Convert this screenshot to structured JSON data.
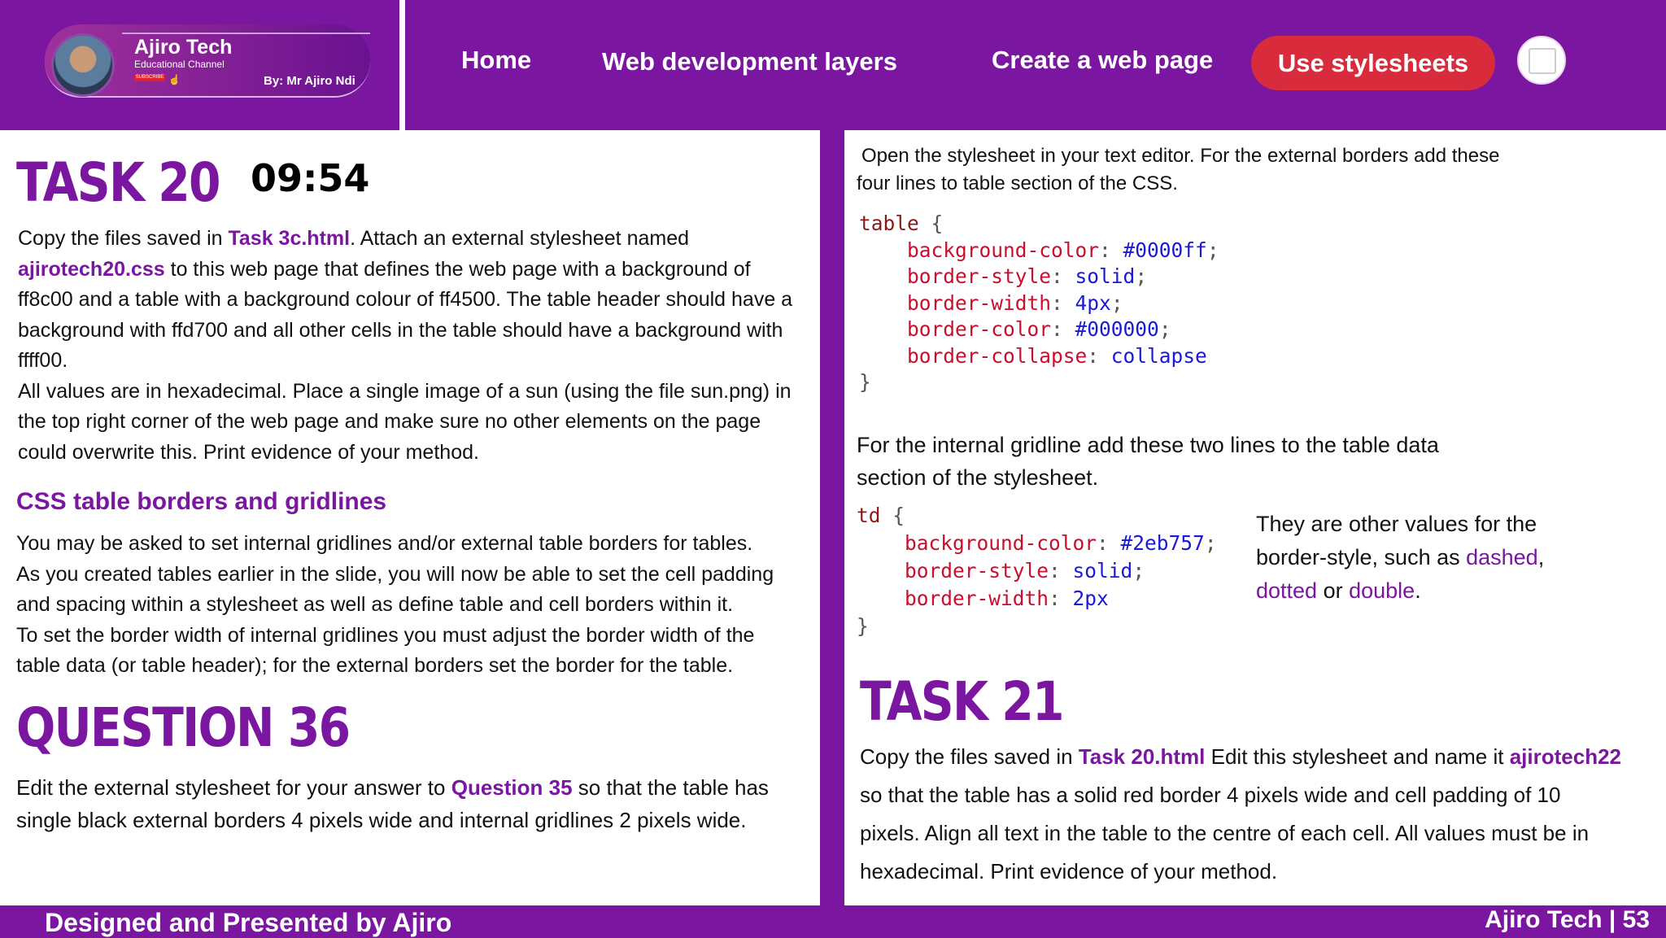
{
  "header": {
    "brand_title": "Ajiro Tech",
    "brand_sub": "Educational Channel",
    "subscribe_label": "SUBSCRIBE",
    "byline": "By: Mr Ajiro Ndi",
    "nav": [
      "Home",
      "Web development layers",
      "Create a web page",
      "Use stylesheets"
    ]
  },
  "left": {
    "task_title": "TASK 20",
    "timer": "09:54",
    "task_text": {
      "p1_a": "Copy the files saved in ",
      "p1_link": "Task 3c.html",
      "p1_b": ". Attach an external stylesheet named",
      "p2_link": "ajirotech20.css",
      "p2_b": " to this web page that defines the web page with a background of",
      "line3": "ff8c00 and a table with a background colour of ff4500. The table header should have a",
      "line4": "background with ffd700 and all other cells in the table should have a background with",
      "line5": "ffff00.",
      "line6": "All values are in hexadecimal. Place a single image of a sun (using the file sun.png) in",
      "line7": "the top right corner of the web page and make sure no other elements on the page",
      "line8": "could overwrite this. Print evidence of your method."
    },
    "subhead": "CSS table borders and gridlines",
    "borders_text": [
      "You may be asked to set internal gridlines and/or external table borders for tables.",
      "As you created tables earlier in the slide, you will now be able to set the cell padding",
      "and spacing within a stylesheet as well as define table and cell borders within it.",
      "To set the border width of internal gridlines you must adjust the border width of the",
      "table data (or table header); for the external borders set the border for the table."
    ],
    "question_title": "QUESTION 36",
    "question_text": {
      "a": "Edit the external stylesheet for your answer to ",
      "link": "Question 35",
      "b": " so that the table has",
      "line2": "single black external borders 4 pixels wide and internal gridlines 2 pixels wide."
    }
  },
  "right": {
    "intro": [
      "Open the stylesheet in your text editor. For the external borders add these",
      "four lines to table section of the CSS."
    ],
    "code_table": {
      "selector": "table",
      "open": "{",
      "close": "}",
      "decls": [
        {
          "prop": "background-color",
          "value": "#0000ff"
        },
        {
          "prop": "border-style",
          "value": "solid"
        },
        {
          "prop": "border-width",
          "value": "4px"
        },
        {
          "prop": "border-color",
          "value": "#000000"
        },
        {
          "prop": "border-collapse",
          "value": "collapse",
          "nosemi": true
        }
      ]
    },
    "gridline_text": [
      "For the internal gridline add these two lines to the table data",
      "section of the stylesheet."
    ],
    "code_td": {
      "selector": "td",
      "open": "{",
      "close": "}",
      "decls": [
        {
          "prop": "background-color",
          "value": "#2eb757"
        },
        {
          "prop": "border-style",
          "value": "solid"
        },
        {
          "prop": "border-width",
          "value": "2px",
          "nosemi": true
        }
      ]
    },
    "note": {
      "line1": "They are other values for the",
      "line2_a": "border-style, such as ",
      "dashed": "dashed",
      "comma": ",",
      "dotted": "dotted",
      "or": " or ",
      "double": "double",
      "period": "."
    },
    "task21_title": "TASK 21",
    "task21": {
      "a": "Copy the files saved in ",
      "link1": "Task 20.html",
      "b": " Edit this stylesheet and name it ",
      "link2": "ajirotech22",
      "line2": "so that the table has a solid red border 4 pixels wide and cell padding of 10",
      "line3": "pixels. Align all text in the table to the centre of each cell. All values must be in",
      "line4": "hexadecimal. Print evidence of your method."
    }
  },
  "footer": {
    "left": "Designed and Presented by Ajiro",
    "right": "Ajiro Tech | 53"
  },
  "colors": {
    "brand_purple": "#7a16a0",
    "active_nav": "#d82c3c",
    "css_property": "#c8102e",
    "css_value": "#1a1ad6"
  }
}
